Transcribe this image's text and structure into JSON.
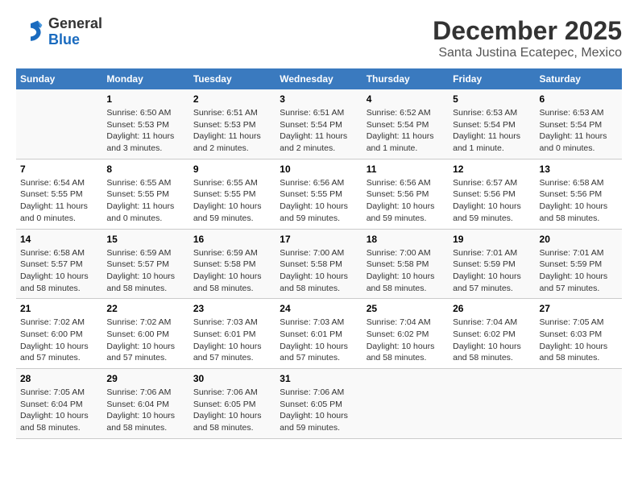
{
  "logo": {
    "general": "General",
    "blue": "Blue"
  },
  "title": "December 2025",
  "subtitle": "Santa Justina Ecatepec, Mexico",
  "weekdays": [
    "Sunday",
    "Monday",
    "Tuesday",
    "Wednesday",
    "Thursday",
    "Friday",
    "Saturday"
  ],
  "weeks": [
    [
      {
        "day": "",
        "sunrise": "",
        "sunset": "",
        "daylight": ""
      },
      {
        "day": "1",
        "sunrise": "Sunrise: 6:50 AM",
        "sunset": "Sunset: 5:53 PM",
        "daylight": "Daylight: 11 hours and 3 minutes."
      },
      {
        "day": "2",
        "sunrise": "Sunrise: 6:51 AM",
        "sunset": "Sunset: 5:53 PM",
        "daylight": "Daylight: 11 hours and 2 minutes."
      },
      {
        "day": "3",
        "sunrise": "Sunrise: 6:51 AM",
        "sunset": "Sunset: 5:54 PM",
        "daylight": "Daylight: 11 hours and 2 minutes."
      },
      {
        "day": "4",
        "sunrise": "Sunrise: 6:52 AM",
        "sunset": "Sunset: 5:54 PM",
        "daylight": "Daylight: 11 hours and 1 minute."
      },
      {
        "day": "5",
        "sunrise": "Sunrise: 6:53 AM",
        "sunset": "Sunset: 5:54 PM",
        "daylight": "Daylight: 11 hours and 1 minute."
      },
      {
        "day": "6",
        "sunrise": "Sunrise: 6:53 AM",
        "sunset": "Sunset: 5:54 PM",
        "daylight": "Daylight: 11 hours and 0 minutes."
      }
    ],
    [
      {
        "day": "7",
        "sunrise": "Sunrise: 6:54 AM",
        "sunset": "Sunset: 5:55 PM",
        "daylight": "Daylight: 11 hours and 0 minutes."
      },
      {
        "day": "8",
        "sunrise": "Sunrise: 6:55 AM",
        "sunset": "Sunset: 5:55 PM",
        "daylight": "Daylight: 11 hours and 0 minutes."
      },
      {
        "day": "9",
        "sunrise": "Sunrise: 6:55 AM",
        "sunset": "Sunset: 5:55 PM",
        "daylight": "Daylight: 10 hours and 59 minutes."
      },
      {
        "day": "10",
        "sunrise": "Sunrise: 6:56 AM",
        "sunset": "Sunset: 5:55 PM",
        "daylight": "Daylight: 10 hours and 59 minutes."
      },
      {
        "day": "11",
        "sunrise": "Sunrise: 6:56 AM",
        "sunset": "Sunset: 5:56 PM",
        "daylight": "Daylight: 10 hours and 59 minutes."
      },
      {
        "day": "12",
        "sunrise": "Sunrise: 6:57 AM",
        "sunset": "Sunset: 5:56 PM",
        "daylight": "Daylight: 10 hours and 59 minutes."
      },
      {
        "day": "13",
        "sunrise": "Sunrise: 6:58 AM",
        "sunset": "Sunset: 5:56 PM",
        "daylight": "Daylight: 10 hours and 58 minutes."
      }
    ],
    [
      {
        "day": "14",
        "sunrise": "Sunrise: 6:58 AM",
        "sunset": "Sunset: 5:57 PM",
        "daylight": "Daylight: 10 hours and 58 minutes."
      },
      {
        "day": "15",
        "sunrise": "Sunrise: 6:59 AM",
        "sunset": "Sunset: 5:57 PM",
        "daylight": "Daylight: 10 hours and 58 minutes."
      },
      {
        "day": "16",
        "sunrise": "Sunrise: 6:59 AM",
        "sunset": "Sunset: 5:58 PM",
        "daylight": "Daylight: 10 hours and 58 minutes."
      },
      {
        "day": "17",
        "sunrise": "Sunrise: 7:00 AM",
        "sunset": "Sunset: 5:58 PM",
        "daylight": "Daylight: 10 hours and 58 minutes."
      },
      {
        "day": "18",
        "sunrise": "Sunrise: 7:00 AM",
        "sunset": "Sunset: 5:58 PM",
        "daylight": "Daylight: 10 hours and 58 minutes."
      },
      {
        "day": "19",
        "sunrise": "Sunrise: 7:01 AM",
        "sunset": "Sunset: 5:59 PM",
        "daylight": "Daylight: 10 hours and 57 minutes."
      },
      {
        "day": "20",
        "sunrise": "Sunrise: 7:01 AM",
        "sunset": "Sunset: 5:59 PM",
        "daylight": "Daylight: 10 hours and 57 minutes."
      }
    ],
    [
      {
        "day": "21",
        "sunrise": "Sunrise: 7:02 AM",
        "sunset": "Sunset: 6:00 PM",
        "daylight": "Daylight: 10 hours and 57 minutes."
      },
      {
        "day": "22",
        "sunrise": "Sunrise: 7:02 AM",
        "sunset": "Sunset: 6:00 PM",
        "daylight": "Daylight: 10 hours and 57 minutes."
      },
      {
        "day": "23",
        "sunrise": "Sunrise: 7:03 AM",
        "sunset": "Sunset: 6:01 PM",
        "daylight": "Daylight: 10 hours and 57 minutes."
      },
      {
        "day": "24",
        "sunrise": "Sunrise: 7:03 AM",
        "sunset": "Sunset: 6:01 PM",
        "daylight": "Daylight: 10 hours and 57 minutes."
      },
      {
        "day": "25",
        "sunrise": "Sunrise: 7:04 AM",
        "sunset": "Sunset: 6:02 PM",
        "daylight": "Daylight: 10 hours and 58 minutes."
      },
      {
        "day": "26",
        "sunrise": "Sunrise: 7:04 AM",
        "sunset": "Sunset: 6:02 PM",
        "daylight": "Daylight: 10 hours and 58 minutes."
      },
      {
        "day": "27",
        "sunrise": "Sunrise: 7:05 AM",
        "sunset": "Sunset: 6:03 PM",
        "daylight": "Daylight: 10 hours and 58 minutes."
      }
    ],
    [
      {
        "day": "28",
        "sunrise": "Sunrise: 7:05 AM",
        "sunset": "Sunset: 6:04 PM",
        "daylight": "Daylight: 10 hours and 58 minutes."
      },
      {
        "day": "29",
        "sunrise": "Sunrise: 7:06 AM",
        "sunset": "Sunset: 6:04 PM",
        "daylight": "Daylight: 10 hours and 58 minutes."
      },
      {
        "day": "30",
        "sunrise": "Sunrise: 7:06 AM",
        "sunset": "Sunset: 6:05 PM",
        "daylight": "Daylight: 10 hours and 58 minutes."
      },
      {
        "day": "31",
        "sunrise": "Sunrise: 7:06 AM",
        "sunset": "Sunset: 6:05 PM",
        "daylight": "Daylight: 10 hours and 59 minutes."
      },
      {
        "day": "",
        "sunrise": "",
        "sunset": "",
        "daylight": ""
      },
      {
        "day": "",
        "sunrise": "",
        "sunset": "",
        "daylight": ""
      },
      {
        "day": "",
        "sunrise": "",
        "sunset": "",
        "daylight": ""
      }
    ]
  ]
}
